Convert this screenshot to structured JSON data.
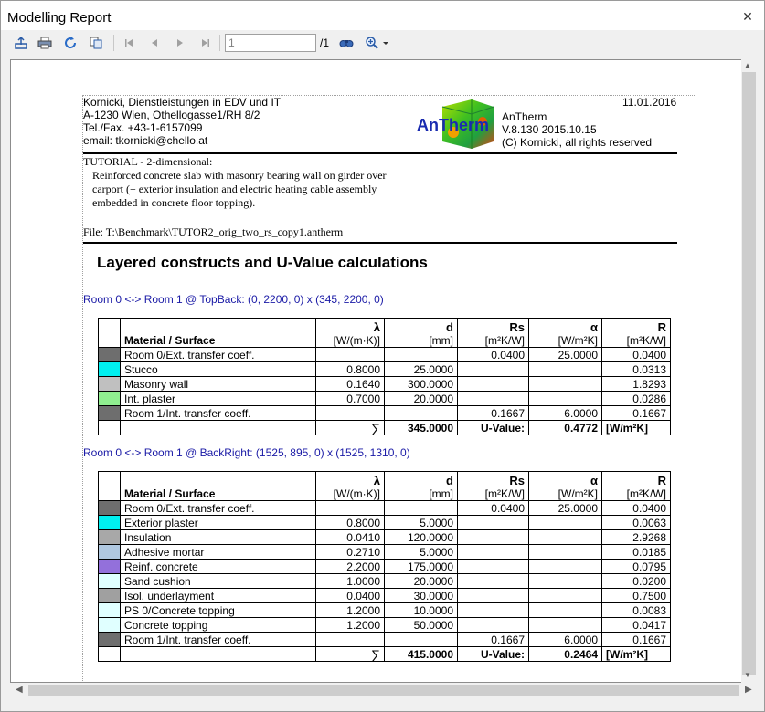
{
  "window": {
    "title": "Modelling Report"
  },
  "toolbar": {
    "page_value": "1",
    "page_total": "/1",
    "icons": [
      "export-icon",
      "print-icon",
      "refresh-icon",
      "copy-icon",
      "first-page-icon",
      "prev-page-icon",
      "next-page-icon",
      "last-page-icon",
      "find-icon",
      "zoom-icon"
    ]
  },
  "report": {
    "company_lines": [
      "Kornicki, Dienstleistungen in EDV und IT",
      "A-1230 Wien, Othellogasse1/RH 8/2",
      "Tel./Fax. +43-1-6157099",
      "email: tkornicki@chello.at"
    ],
    "date": "11.01.2016",
    "logo_text": "AnTherm",
    "product_lines": [
      "AnTherm",
      "V.8.130 2015.10.15",
      "(C) Kornicki, all rights reserved"
    ],
    "tutorial_title": "TUTORIAL - 2-dimensional:",
    "tutorial_desc": [
      "Reinforced concrete slab with masonry bearing wall on girder over",
      "carport (+ exterior insulation and electric heating cable assembly",
      "embedded in concrete floor topping)."
    ],
    "file_line": "File:  T:\\Benchmark\\TUTOR2_orig_two_rs_copy1.antherm",
    "section_title": "Layered constructs and U-Value calculations",
    "headers": {
      "material": "Material / Surface",
      "lambda_sym": "λ",
      "lambda_unit": "[W/(m·K)]",
      "d_sym": "d",
      "d_unit": "[mm]",
      "rs_sym": "Rs",
      "rs_unit": "[m²K/W]",
      "alpha_sym": "α",
      "alpha_unit": "[W/m²K]",
      "r_sym": "R",
      "r_unit": "[m²K/W]"
    },
    "tables": [
      {
        "caption": "Room 0 <-> Room 1 @ TopBack: (0, 2200, 0) x (345, 2200, 0)",
        "rows": [
          {
            "color": "#6e6e6e",
            "name": "Room 0/Ext. transfer coeff.",
            "lambda": "",
            "d": "",
            "rs": "0.0400",
            "alpha": "25.0000",
            "r": "0.0400"
          },
          {
            "color": "#00f0f0",
            "name": "Stucco",
            "lambda": "0.8000",
            "d": "25.0000",
            "rs": "",
            "alpha": "",
            "r": "0.0313"
          },
          {
            "color": "#c0c0c0",
            "name": "Masonry wall",
            "lambda": "0.1640",
            "d": "300.0000",
            "rs": "",
            "alpha": "",
            "r": "1.8293"
          },
          {
            "color": "#90ee90",
            "name": "Int. plaster",
            "lambda": "0.7000",
            "d": "20.0000",
            "rs": "",
            "alpha": "",
            "r": "0.0286"
          },
          {
            "color": "#6e6e6e",
            "name": "Room 1/Int. transfer coeff.",
            "lambda": "",
            "d": "",
            "rs": "0.1667",
            "alpha": "6.0000",
            "r": "0.1667"
          }
        ],
        "total": {
          "sum_sym": "∑",
          "d_total": "345.0000",
          "u_label": "U-Value:",
          "u_value": "0.4772",
          "u_unit": "[W/m²K]"
        }
      },
      {
        "caption": "Room 0 <-> Room 1 @ BackRight: (1525, 895, 0) x (1525, 1310, 0)",
        "rows": [
          {
            "color": "#6e6e6e",
            "name": "Room 0/Ext. transfer coeff.",
            "lambda": "",
            "d": "",
            "rs": "0.0400",
            "alpha": "25.0000",
            "r": "0.0400"
          },
          {
            "color": "#00f0f0",
            "name": "Exterior plaster",
            "lambda": "0.8000",
            "d": "5.0000",
            "rs": "",
            "alpha": "",
            "r": "0.0063"
          },
          {
            "color": "#a8a8a8",
            "name": "Insulation",
            "lambda": "0.0410",
            "d": "120.0000",
            "rs": "",
            "alpha": "",
            "r": "2.9268"
          },
          {
            "color": "#b0c8e0",
            "name": "Adhesive mortar",
            "lambda": "0.2710",
            "d": "5.0000",
            "rs": "",
            "alpha": "",
            "r": "0.0185"
          },
          {
            "color": "#9370db",
            "name": "Reinf. concrete",
            "lambda": "2.2000",
            "d": "175.0000",
            "rs": "",
            "alpha": "",
            "r": "0.0795"
          },
          {
            "color": "#e0ffff",
            "name": "Sand cushion",
            "lambda": "1.0000",
            "d": "20.0000",
            "rs": "",
            "alpha": "",
            "r": "0.0200"
          },
          {
            "color": "#a0a0a0",
            "name": "Isol. underlayment",
            "lambda": "0.0400",
            "d": "30.0000",
            "rs": "",
            "alpha": "",
            "r": "0.7500"
          },
          {
            "color": "#e0ffff",
            "name": "PS 0/Concrete topping",
            "lambda": "1.2000",
            "d": "10.0000",
            "rs": "",
            "alpha": "",
            "r": "0.0083"
          },
          {
            "color": "#e0ffff",
            "name": "Concrete topping",
            "lambda": "1.2000",
            "d": "50.0000",
            "rs": "",
            "alpha": "",
            "r": "0.0417"
          },
          {
            "color": "#6e6e6e",
            "name": "Room 1/Int. transfer coeff.",
            "lambda": "",
            "d": "",
            "rs": "0.1667",
            "alpha": "6.0000",
            "r": "0.1667"
          }
        ],
        "total": {
          "sum_sym": "∑",
          "d_total": "415.0000",
          "u_label": "U-Value:",
          "u_value": "0.2464",
          "u_unit": "[W/m²K]"
        }
      }
    ]
  }
}
